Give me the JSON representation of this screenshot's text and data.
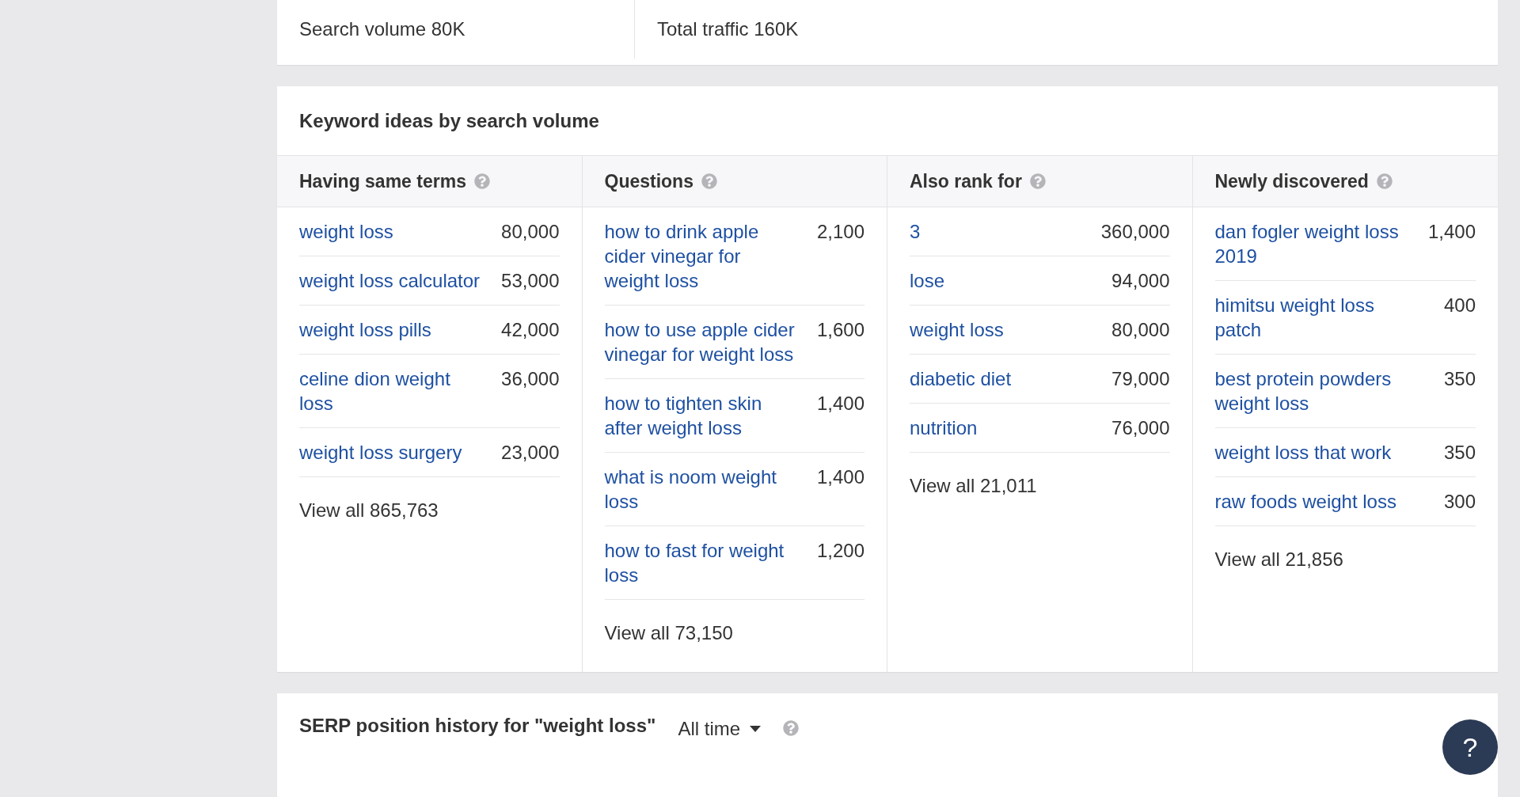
{
  "summary": [
    {
      "text": "Search volume 80K"
    },
    {
      "text": "Total traffic 160K"
    }
  ],
  "keyword_ideas": {
    "title": "Keyword ideas by search volume",
    "columns": [
      {
        "heading": "Having same terms",
        "rows": [
          {
            "keyword": "weight loss",
            "volume": "80,000"
          },
          {
            "keyword": "weight loss calculator",
            "volume": "53,000"
          },
          {
            "keyword": "weight loss pills",
            "volume": "42,000"
          },
          {
            "keyword": "celine dion weight loss",
            "volume": "36,000"
          },
          {
            "keyword": "weight loss surgery",
            "volume": "23,000"
          }
        ],
        "view_all": "View all 865,763"
      },
      {
        "heading": "Questions",
        "rows": [
          {
            "keyword": "how to drink apple cider vinegar for weight loss",
            "volume": "2,100"
          },
          {
            "keyword": "how to use apple cider vinegar for weight loss",
            "volume": "1,600"
          },
          {
            "keyword": "how to tighten skin after weight loss",
            "volume": "1,400"
          },
          {
            "keyword": "what is noom weight loss",
            "volume": "1,400"
          },
          {
            "keyword": "how to fast for weight loss",
            "volume": "1,200"
          }
        ],
        "view_all": "View all 73,150"
      },
      {
        "heading": "Also rank for",
        "rows": [
          {
            "keyword": "3",
            "volume": "360,000"
          },
          {
            "keyword": "lose",
            "volume": "94,000"
          },
          {
            "keyword": "weight loss",
            "volume": "80,000"
          },
          {
            "keyword": "diabetic diet",
            "volume": "79,000"
          },
          {
            "keyword": "nutrition",
            "volume": "76,000"
          }
        ],
        "view_all": "View all 21,011"
      },
      {
        "heading": "Newly discovered",
        "rows": [
          {
            "keyword": "dan fogler weight loss 2019",
            "volume": "1,400"
          },
          {
            "keyword": "himitsu weight loss patch",
            "volume": "400"
          },
          {
            "keyword": "best protein powders weight loss",
            "volume": "350"
          },
          {
            "keyword": "weight loss that work",
            "volume": "350"
          },
          {
            "keyword": "raw foods weight loss",
            "volume": "300"
          }
        ],
        "view_all": "View all 21,856"
      }
    ]
  },
  "serp_history": {
    "title": "SERP position history for \"weight loss\"",
    "period": "All time"
  },
  "help_button": "?"
}
